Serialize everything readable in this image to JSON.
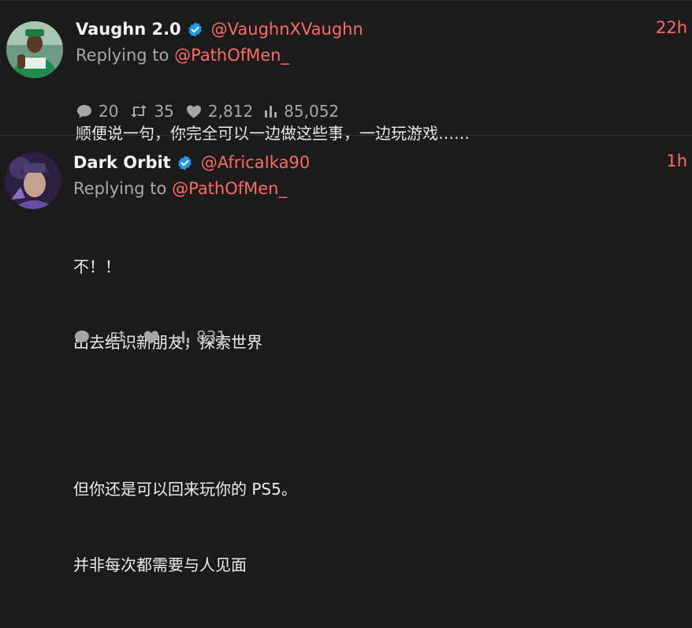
{
  "tweets": [
    {
      "display_name": "Vaughn 2.0",
      "handle": "@VaughnXVaughn",
      "time": "22h",
      "reply_prefix": "Replying to",
      "reply_to": "@PathOfMen_",
      "body": [
        "顺便说一句，你完全可以一边做这些事，一边玩游戏……"
      ],
      "stats": {
        "replies": "20",
        "retweets": "35",
        "likes": "2,812",
        "views": "85,052"
      },
      "verified": true
    },
    {
      "display_name": "Dark Orbit",
      "handle": "@AfricaIka90",
      "time": "1h",
      "reply_prefix": "Replying to",
      "reply_to": "@PathOfMen_",
      "body": [
        "不！！",
        "出去结识新朋友，探索世界",
        "",
        "但你还是可以回来玩你的 PS5。",
        "并非每次都需要与人见面"
      ],
      "stats": {
        "replies": "",
        "retweets": "",
        "likes": "",
        "views": "831"
      },
      "verified": true
    }
  ],
  "colors": {
    "background": "#1b1b1b",
    "accent": "#ff6b63",
    "muted": "#a8a8a8",
    "verified": "#1d9bf0"
  },
  "icons": [
    "reply-icon",
    "retweet-icon",
    "like-icon",
    "views-icon",
    "verified-badge-icon"
  ]
}
